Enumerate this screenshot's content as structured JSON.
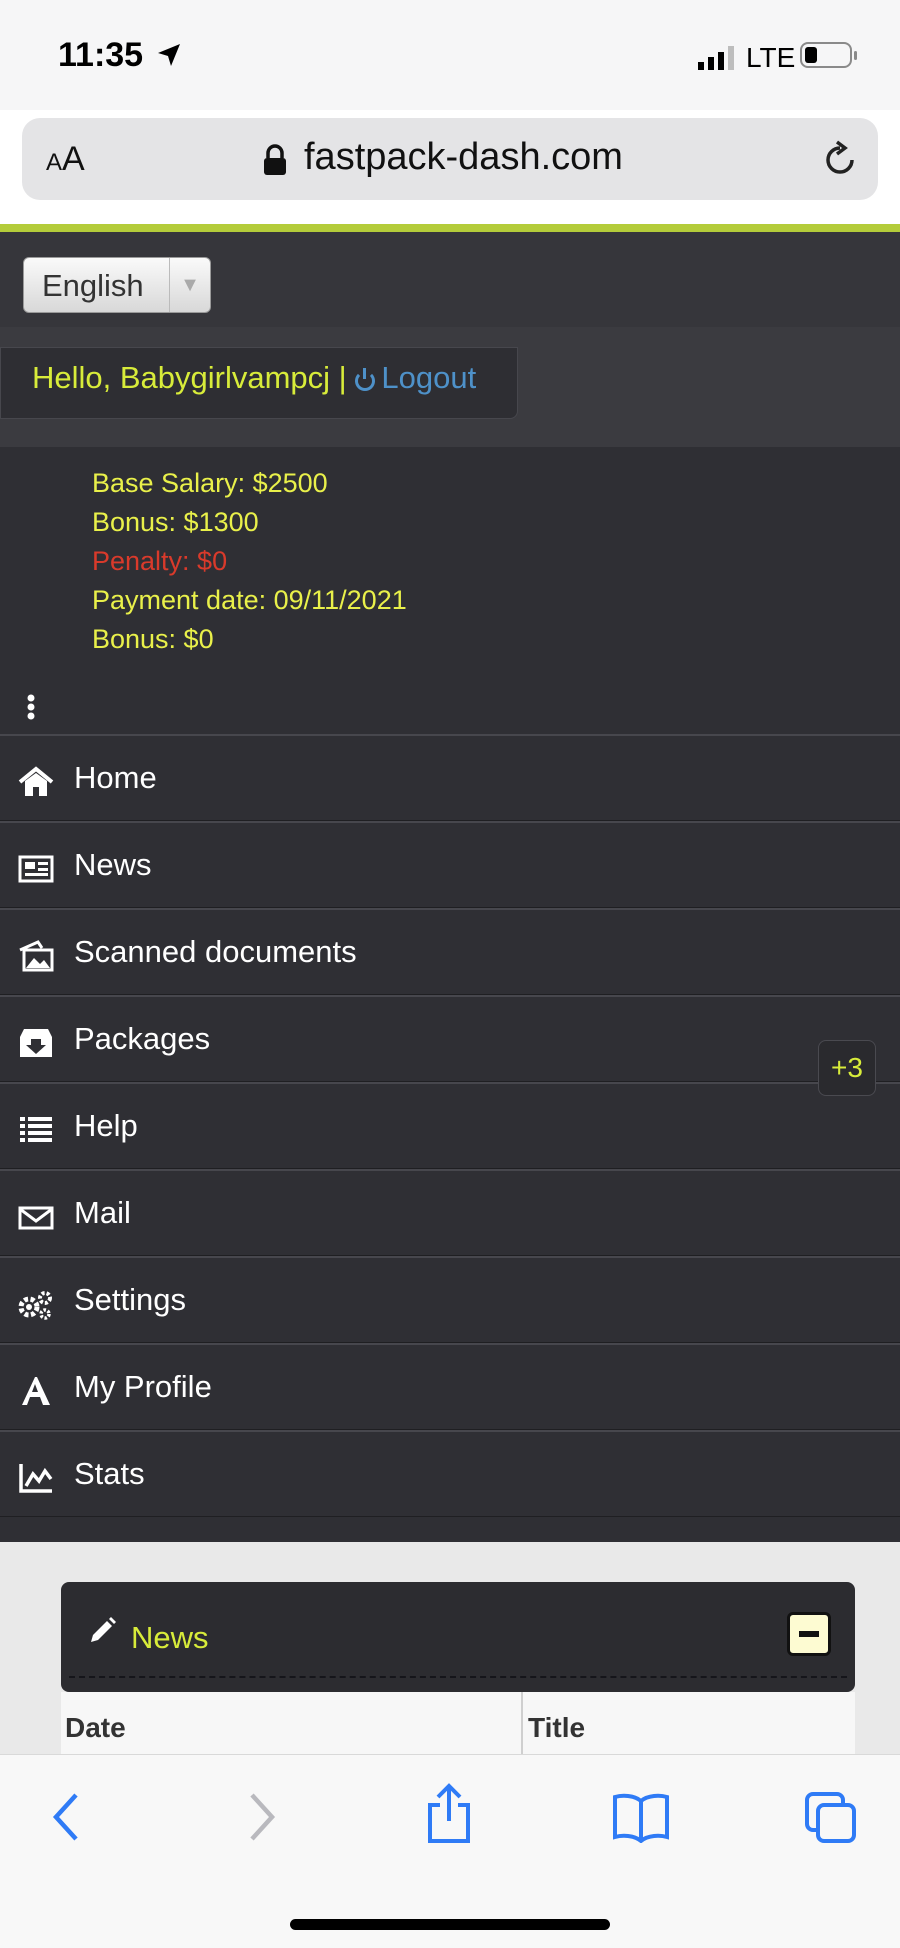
{
  "status_bar": {
    "time": "11:35",
    "network": "LTE"
  },
  "browser": {
    "text_size_label": "AA",
    "url": "fastpack-dash.com"
  },
  "site": {
    "language": "English",
    "greeting": "Hello, Babygirlvampcj |",
    "logout_label": "Logout",
    "info": {
      "base_salary": "Base Salary: $2500",
      "bonus1": "Bonus: $1300",
      "penalty": "Penalty: $0",
      "payment_date": "Payment date: 09/11/2021",
      "bonus2": "Bonus: $0"
    },
    "menu": [
      {
        "label": "Home",
        "icon": "home-icon"
      },
      {
        "label": "News",
        "icon": "newspaper-icon"
      },
      {
        "label": "Scanned documents",
        "icon": "image-icon"
      },
      {
        "label": "Packages",
        "icon": "inbox-download-icon"
      },
      {
        "label": "Help",
        "icon": "list-icon"
      },
      {
        "label": "Mail",
        "icon": "envelope-icon"
      },
      {
        "label": "Settings",
        "icon": "gears-icon"
      },
      {
        "label": "My Profile",
        "icon": "font-icon"
      },
      {
        "label": "Stats",
        "icon": "chart-icon"
      }
    ],
    "packages_badge": "+3",
    "news_panel": {
      "title": "News",
      "col_date": "Date",
      "col_title": "Title"
    }
  },
  "colors": {
    "accent": "#b4cc3a",
    "greeting": "#d8ec3a",
    "link": "#4e91c9",
    "penalty": "#d93a2b",
    "background": "#2f2f34"
  }
}
